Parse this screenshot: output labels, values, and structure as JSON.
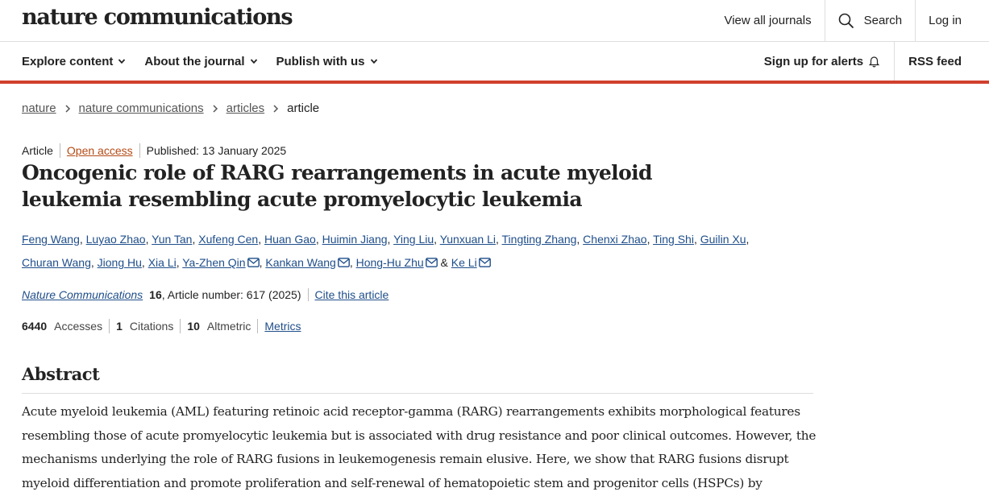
{
  "header": {
    "logo": "nature communications",
    "view_all_journals": "View all journals",
    "search": "Search",
    "login": "Log in"
  },
  "nav": {
    "explore": "Explore content",
    "about": "About the journal",
    "publish": "Publish with us",
    "alerts": "Sign up for alerts",
    "rss": "RSS feed"
  },
  "breadcrumb": {
    "items": [
      "nature",
      "nature communications",
      "articles"
    ],
    "current": "article"
  },
  "article": {
    "type": "Article",
    "access": "Open access",
    "published": "Published: 13 January 2025",
    "title": "Oncogenic role of RARG rearrangements in acute myeloid leukemia resembling acute promyelocytic leukemia",
    "authors": [
      "Feng Wang",
      "Luyao Zhao",
      "Yun Tan",
      "Xufeng Cen",
      "Huan Gao",
      "Huimin Jiang",
      "Ying Liu",
      "Yunxuan Li",
      "Tingting Zhang",
      "Chenxi Zhao",
      "Ting Shi",
      "Guilin Xu",
      "Churan Wang",
      "Jiong Hu",
      "Xia Li",
      "Ya-Zhen Qin",
      "Kankan Wang",
      "Hong-Hu Zhu",
      "Ke Li"
    ],
    "journal": "Nature Communications",
    "volume": "16",
    "article_number": ", Article number: 617 (2025)",
    "cite": "Cite this article"
  },
  "metrics": {
    "accesses_value": "6440",
    "accesses_label": "Accesses",
    "citations_value": "1",
    "citations_label": "Citations",
    "altmetric_value": "10",
    "altmetric_label": "Altmetric",
    "metrics_link": "Metrics"
  },
  "abstract": {
    "heading": "Abstract",
    "text": "Acute myeloid leukemia (AML) featuring retinoic acid receptor-gamma (RARG) rearrangements exhibits morphological features resembling those of acute promyelocytic leukemia but is associated with drug resistance and poor clinical outcomes. However, the mechanisms underlying the role of RARG fusions in leukemogenesis remain elusive. Here, we show that RARG fusions disrupt myeloid differentiation and promote proliferation and self-renewal of hematopoietic stem and progenitor cells (HSPCs) by"
  },
  "colors": {
    "accent_rule": "#d0402e",
    "link": "#1f4e8a",
    "open_access": "#b44a15"
  }
}
